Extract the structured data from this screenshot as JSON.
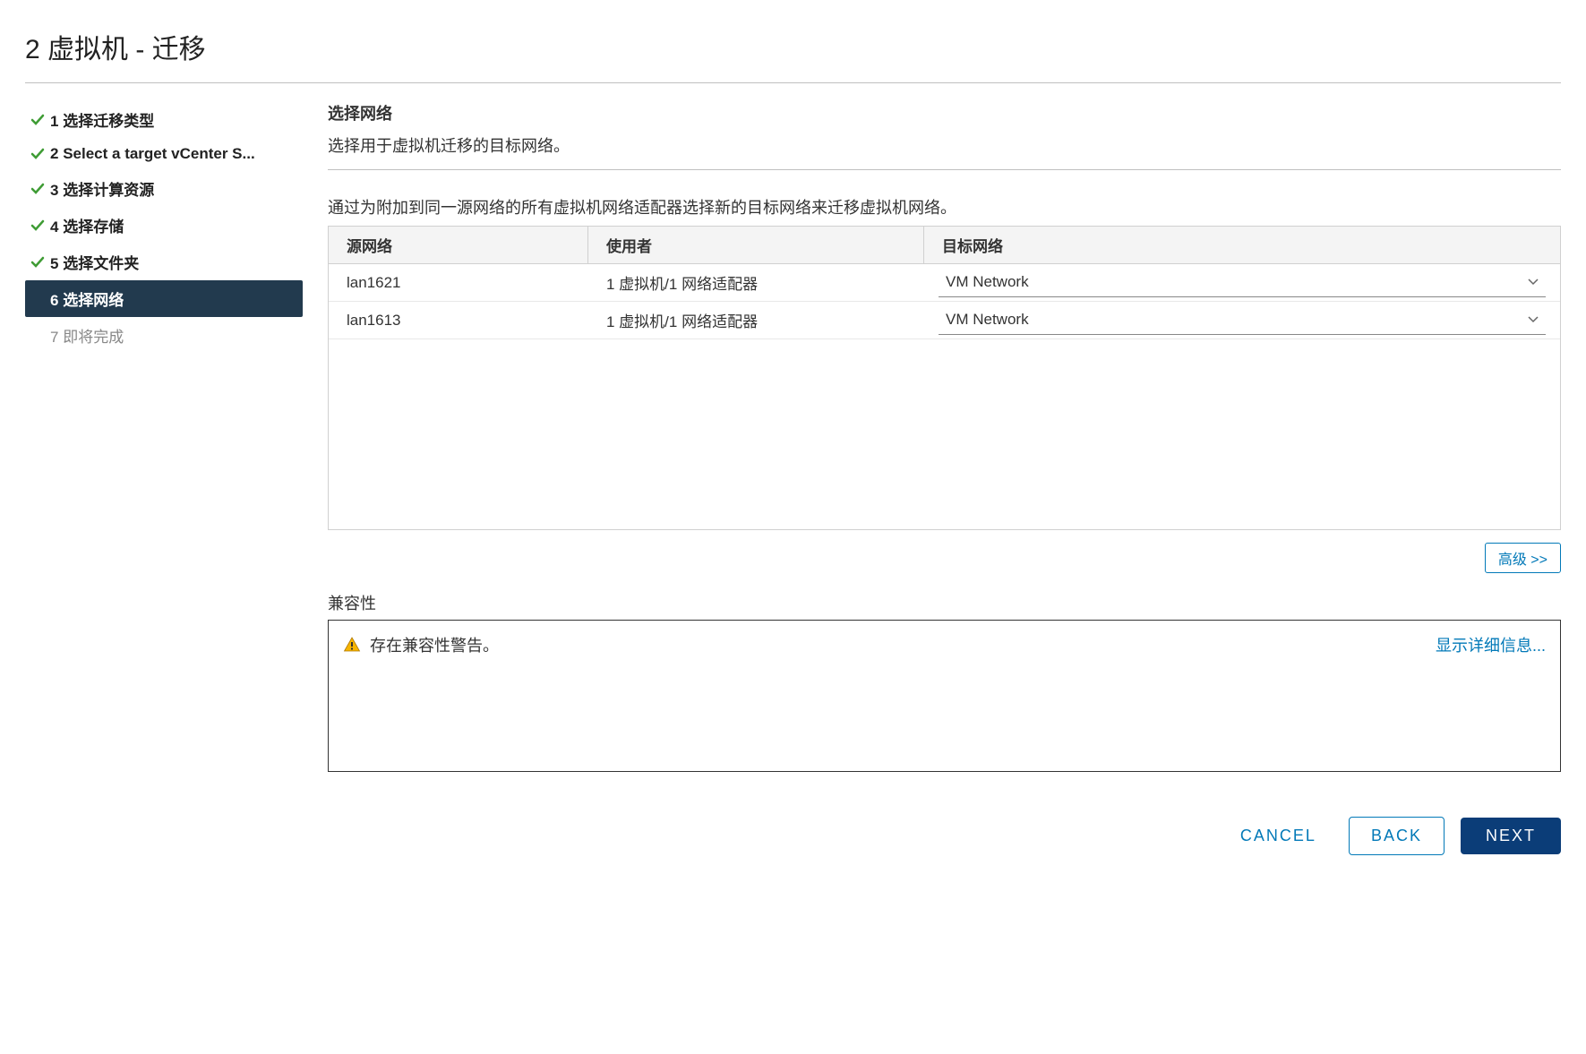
{
  "title": "2 虚拟机 - 迁移",
  "steps": [
    {
      "num": "1",
      "label": "选择迁移类型",
      "status": "done"
    },
    {
      "num": "2",
      "label": "Select a target vCenter S...",
      "status": "done"
    },
    {
      "num": "3",
      "label": "选择计算资源",
      "status": "done"
    },
    {
      "num": "4",
      "label": "选择存储",
      "status": "done"
    },
    {
      "num": "5",
      "label": "选择文件夹",
      "status": "done"
    },
    {
      "num": "6",
      "label": "选择网络",
      "status": "active"
    },
    {
      "num": "7",
      "label": "即将完成",
      "status": "pending"
    }
  ],
  "main": {
    "heading": "选择网络",
    "sub": "选择用于虚拟机迁移的目标网络。",
    "instruction": "通过为附加到同一源网络的所有虚拟机网络适配器选择新的目标网络来迁移虚拟机网络。",
    "columns": {
      "src": "源网络",
      "usedby": "使用者",
      "target": "目标网络"
    },
    "rows": [
      {
        "src": "lan1621",
        "usedby": "1 虚拟机/1 网络适配器",
        "target": "VM Network"
      },
      {
        "src": "lan1613",
        "usedby": "1 虚拟机/1 网络适配器",
        "target": "VM Network"
      }
    ],
    "advanced": "高级 >>"
  },
  "compat": {
    "label": "兼容性",
    "message": "存在兼容性警告。",
    "details": "显示详细信息..."
  },
  "footer": {
    "cancel": "CANCEL",
    "back": "BACK",
    "next": "NEXT"
  }
}
